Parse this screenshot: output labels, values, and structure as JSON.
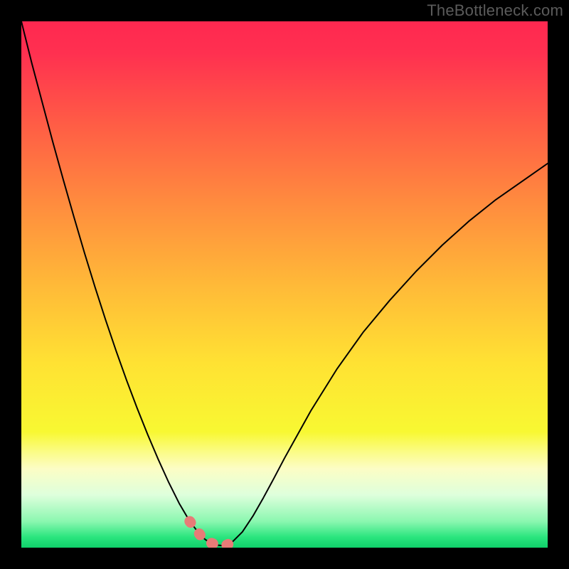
{
  "watermark": "TheBottleneck.com",
  "chart_data": {
    "type": "line",
    "title": "",
    "xlabel": "",
    "ylabel": "",
    "x": [
      0,
      2,
      4,
      6,
      8,
      10,
      12,
      14,
      16,
      18,
      20,
      22,
      24,
      26,
      28,
      30,
      32,
      34,
      35,
      36,
      37,
      38,
      39,
      40,
      42,
      44,
      46,
      48,
      50,
      55,
      60,
      65,
      70,
      75,
      80,
      85,
      90,
      95,
      100
    ],
    "values": [
      100,
      92,
      84.5,
      77,
      69.8,
      62.8,
      56,
      49.5,
      43.3,
      37.4,
      31.8,
      26.5,
      21.5,
      16.8,
      12.4,
      8.4,
      5,
      2.4,
      1.5,
      0.9,
      0.5,
      0.4,
      0.5,
      1,
      3,
      6,
      9.5,
      13.2,
      17,
      26,
      34,
      41,
      47,
      52.5,
      57.5,
      62,
      66,
      69.5,
      73
    ],
    "xlim": [
      0,
      100
    ],
    "ylim": [
      0,
      100
    ],
    "series_name": "bottleneck-curve",
    "optimal_range_x": [
      32,
      40
    ],
    "highlight_color": "#e77b77",
    "background_gradient": {
      "stops": [
        {
          "offset": 0.0,
          "color": "#ff2850"
        },
        {
          "offset": 0.06,
          "color": "#ff3050"
        },
        {
          "offset": 0.2,
          "color": "#ff5e45"
        },
        {
          "offset": 0.35,
          "color": "#ff8d3e"
        },
        {
          "offset": 0.5,
          "color": "#ffb938"
        },
        {
          "offset": 0.65,
          "color": "#ffe233"
        },
        {
          "offset": 0.78,
          "color": "#f8f832"
        },
        {
          "offset": 0.82,
          "color": "#fbfc8a"
        },
        {
          "offset": 0.85,
          "color": "#fcfdc5"
        },
        {
          "offset": 0.9,
          "color": "#deffdc"
        },
        {
          "offset": 0.95,
          "color": "#8bf7b0"
        },
        {
          "offset": 0.98,
          "color": "#2ae57e"
        },
        {
          "offset": 1.0,
          "color": "#0fd06a"
        }
      ]
    }
  }
}
